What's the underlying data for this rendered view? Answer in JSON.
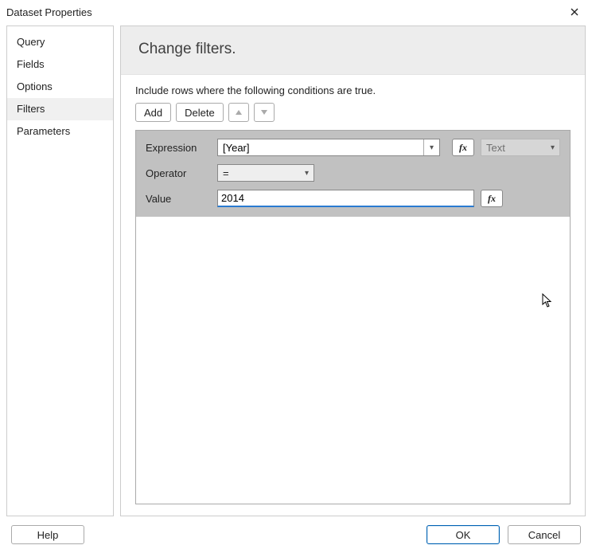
{
  "title": "Dataset Properties",
  "sidebar": {
    "items": [
      {
        "label": "Query"
      },
      {
        "label": "Fields"
      },
      {
        "label": "Options"
      },
      {
        "label": "Filters",
        "selected": true
      },
      {
        "label": "Parameters"
      }
    ]
  },
  "header": {
    "title": "Change filters."
  },
  "instruction": "Include rows where the following conditions are true.",
  "toolbar": {
    "add": "Add",
    "delete": "Delete"
  },
  "filter": {
    "expr_label": "Expression",
    "expr_value": "[Year]",
    "type_text": "Text",
    "op_label": "Operator",
    "op_value": "=",
    "val_label": "Value",
    "val_value": "2014"
  },
  "fx": "fx",
  "footer": {
    "help": "Help",
    "ok": "OK",
    "cancel": "Cancel"
  }
}
